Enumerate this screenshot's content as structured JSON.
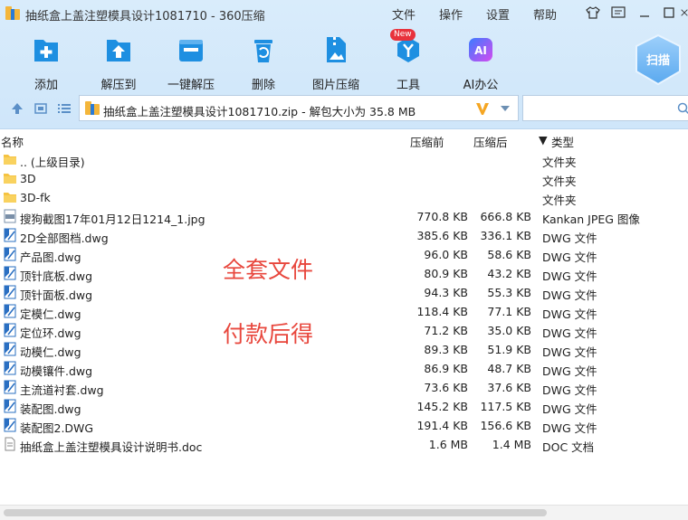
{
  "window": {
    "title": "抽纸盒上盖注塑模具设计1081710 - 360压缩",
    "menu": [
      "文件",
      "操作",
      "设置",
      "帮助"
    ]
  },
  "toolbar": {
    "items": [
      {
        "label": "添加",
        "icon": "add-file-icon"
      },
      {
        "label": "解压到",
        "icon": "extract-to-icon"
      },
      {
        "label": "一键解压",
        "icon": "one-click-extract-icon"
      },
      {
        "label": "删除",
        "icon": "delete-icon"
      },
      {
        "label": "图片压缩",
        "icon": "image-compress-icon"
      },
      {
        "label": "工具",
        "icon": "tools-icon",
        "badge": "New"
      },
      {
        "label": "AI办公",
        "icon": "ai-office-icon"
      }
    ],
    "scan_label": "扫描"
  },
  "address": {
    "text": "抽纸盒上盖注塑模具设计1081710.zip - 解包大小为 35.8 MB"
  },
  "search": {
    "placeholder": ""
  },
  "columns": {
    "name": "名称",
    "before": "压缩前",
    "after": "压缩后",
    "type": "类型",
    "sort_indicator": "▼"
  },
  "files": [
    {
      "name": ".. (上级目录)",
      "before": "",
      "after": "",
      "type": "文件夹",
      "icon": "folder-icon"
    },
    {
      "name": "3D",
      "before": "",
      "after": "",
      "type": "文件夹",
      "icon": "folder-icon"
    },
    {
      "name": "3D-fk",
      "before": "",
      "after": "",
      "type": "文件夹",
      "icon": "folder-icon"
    },
    {
      "name": "搜狗截图17年01月12日1214_1.jpg",
      "before": "770.8 KB",
      "after": "666.8 KB",
      "type": "Kankan JPEG 图像",
      "icon": "jpg-file-icon"
    },
    {
      "name": "2D全部图档.dwg",
      "before": "385.6 KB",
      "after": "336.1 KB",
      "type": "DWG 文件",
      "icon": "dwg-file-icon"
    },
    {
      "name": "产品图.dwg",
      "before": "96.0 KB",
      "after": "58.6 KB",
      "type": "DWG 文件",
      "icon": "dwg-file-icon"
    },
    {
      "name": "顶针底板.dwg",
      "before": "80.9 KB",
      "after": "43.2 KB",
      "type": "DWG 文件",
      "icon": "dwg-file-icon"
    },
    {
      "name": "顶针面板.dwg",
      "before": "94.3 KB",
      "after": "55.3 KB",
      "type": "DWG 文件",
      "icon": "dwg-file-icon"
    },
    {
      "name": "定模仁.dwg",
      "before": "118.4 KB",
      "after": "77.1 KB",
      "type": "DWG 文件",
      "icon": "dwg-file-icon"
    },
    {
      "name": "定位环.dwg",
      "before": "71.2 KB",
      "after": "35.0 KB",
      "type": "DWG 文件",
      "icon": "dwg-file-icon"
    },
    {
      "name": "动模仁.dwg",
      "before": "89.3 KB",
      "after": "51.9 KB",
      "type": "DWG 文件",
      "icon": "dwg-file-icon"
    },
    {
      "name": "动模镶件.dwg",
      "before": "86.9 KB",
      "after": "48.7 KB",
      "type": "DWG 文件",
      "icon": "dwg-file-icon"
    },
    {
      "name": "主流道衬套.dwg",
      "before": "73.6 KB",
      "after": "37.6 KB",
      "type": "DWG 文件",
      "icon": "dwg-file-icon"
    },
    {
      "name": "装配图.dwg",
      "before": "145.2 KB",
      "after": "117.5 KB",
      "type": "DWG 文件",
      "icon": "dwg-file-icon"
    },
    {
      "name": "装配图2.DWG",
      "before": "191.4 KB",
      "after": "156.6 KB",
      "type": "DWG 文件",
      "icon": "dwg-file-icon"
    },
    {
      "name": "抽纸盒上盖注塑模具设计说明书.doc",
      "before": "1.6 MB",
      "after": "1.4 MB",
      "type": "DOC 文档",
      "icon": "doc-file-icon"
    }
  ],
  "overlay": {
    "line1": "全套文件",
    "line2": "付款后得"
  },
  "colors": {
    "accent": "#1e8fe1",
    "overlay_text": "#e8473d",
    "folder": "#f5c342"
  }
}
